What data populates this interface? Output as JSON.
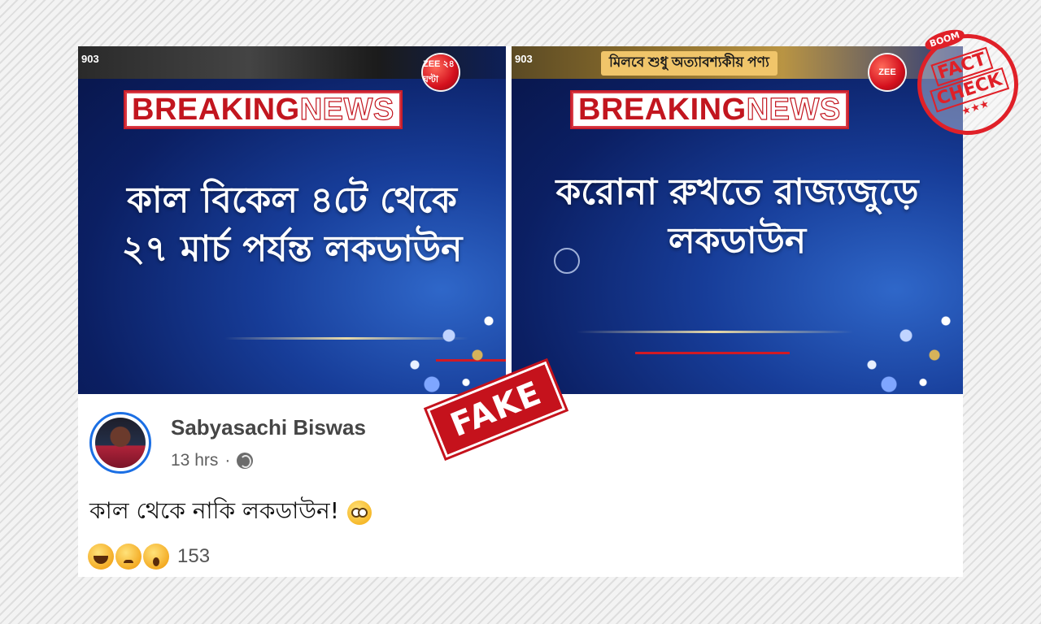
{
  "frames": [
    {
      "channel": "903",
      "logo": "ZEE ২৪ ঘণ্টা",
      "ticker": "",
      "breaking_word": "BREAKING",
      "news_word": "NEWS",
      "headline_line1": "কাল বিকেল ৪টে থেকে",
      "headline_line2": "২৭ মার্চ পর্যন্ত লকডাউন"
    },
    {
      "channel": "903",
      "logo": "ZEE",
      "ticker": "মিলবে শুধু অত্যাবশ্যকীয় পণ্য",
      "breaking_word": "BREAKING",
      "news_word": "NEWS",
      "headline_line1": "করোনা রুখতে রাজ্যজুড়ে",
      "headline_line2": "লকডাউন"
    }
  ],
  "post": {
    "author": "Sabyasachi Biswas",
    "time": "13 hrs",
    "separator": "·",
    "text": "কাল থেকে নাকি লকডাউন!",
    "reaction_count": "153",
    "reactions": [
      "haha-icon",
      "sad-icon",
      "wow-icon"
    ]
  },
  "overlays": {
    "fake_label": "FAKE",
    "stamp_brand": "BOOM",
    "stamp_line1": "FACT",
    "stamp_line2": "CHECK",
    "stamp_stars": "★★★"
  },
  "colors": {
    "stamp_red": "#e02028",
    "news_red": "#c2161f",
    "avatar_ring": "#1b6fe4"
  }
}
